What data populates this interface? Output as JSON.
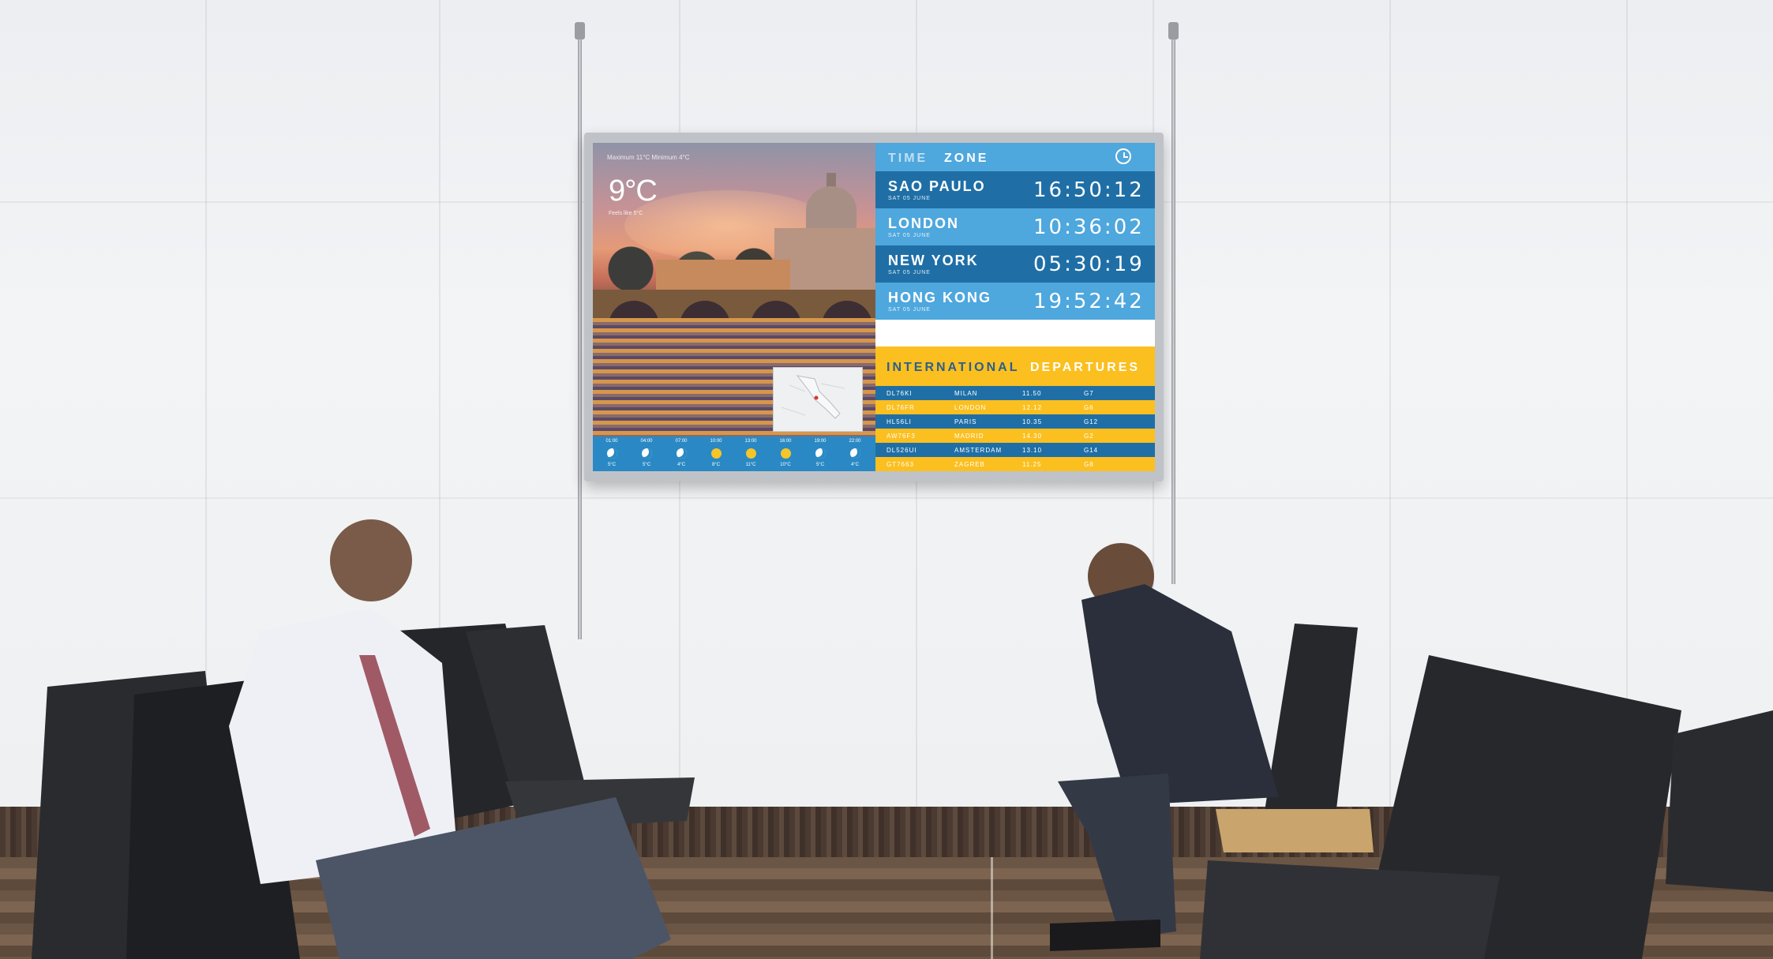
{
  "screen": {
    "weather": {
      "summary": "Maximum 11°C  Minimum 4°C",
      "temperature": "9°C",
      "feels_like": "Feels like 5°C",
      "forecast": [
        {
          "time": "01:00",
          "icon": "moon-icon",
          "temp": "5°C"
        },
        {
          "time": "04:00",
          "icon": "moon-icon",
          "temp": "5°C"
        },
        {
          "time": "07:00",
          "icon": "moon-icon",
          "temp": "4°C"
        },
        {
          "time": "10:00",
          "icon": "sun-icon",
          "temp": "8°C"
        },
        {
          "time": "13:00",
          "icon": "sun-icon",
          "temp": "11°C"
        },
        {
          "time": "16:00",
          "icon": "sun-icon",
          "temp": "10°C"
        },
        {
          "time": "19:00",
          "icon": "moon-icon",
          "temp": "5°C"
        },
        {
          "time": "22:00",
          "icon": "moon-icon",
          "temp": "4°C"
        }
      ]
    },
    "time_zone": {
      "label_first": "TIME",
      "label_second": "ZONE",
      "icon": "clock-icon",
      "cities": [
        {
          "name": "SAO PAULO",
          "date": "SAT 05 JUNE",
          "time": "16:50:12"
        },
        {
          "name": "LONDON",
          "date": "SAT 05 JUNE",
          "time": "10:36:02"
        },
        {
          "name": "NEW YORK",
          "date": "SAT 05 JUNE",
          "time": "05:30:19"
        },
        {
          "name": "HONG KONG",
          "date": "SAT 05 JUNE",
          "time": "19:52:42"
        }
      ]
    },
    "departures": {
      "label_first": "INTERNATIONAL",
      "label_second": "DEPARTURES",
      "flights": [
        {
          "flight": "DL76KI",
          "city": "MILAN",
          "time": "11.50",
          "gate": "G7"
        },
        {
          "flight": "DL76FR",
          "city": "LONDON",
          "time": "12.12",
          "gate": "G6"
        },
        {
          "flight": "HL56LI",
          "city": "PARIS",
          "time": "10.35",
          "gate": "G12"
        },
        {
          "flight": "AW76F3",
          "city": "MADRID",
          "time": "14.30",
          "gate": "G2"
        },
        {
          "flight": "DL526UI",
          "city": "AMSTERDAM",
          "time": "13.10",
          "gate": "G14"
        },
        {
          "flight": "GT7663",
          "city": "ZAGREB",
          "time": "11.25",
          "gate": "G8"
        }
      ]
    },
    "colors": {
      "blue_dark": "#1f6fa6",
      "blue_light": "#4ea7dd",
      "yellow": "#fbbf1f"
    }
  }
}
